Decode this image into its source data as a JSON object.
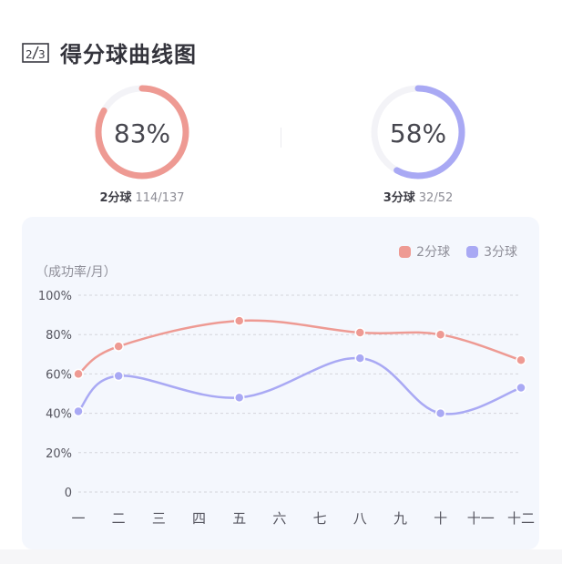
{
  "header": {
    "title": "得分球曲线图",
    "icon": "two-thirds-icon"
  },
  "stats": [
    {
      "percent_text": "83%",
      "value": 0.83,
      "label": "2分球",
      "detail": "114/137",
      "color": "#ee9a93"
    },
    {
      "percent_text": "58%",
      "value": 0.58,
      "label": "3分球",
      "detail": "32/52",
      "color": "#a9a9f4"
    }
  ],
  "chart_data": {
    "type": "line",
    "ylabel": "（成功率/月）",
    "categories": [
      "一",
      "二",
      "三",
      "四",
      "五",
      "六",
      "七",
      "八",
      "九",
      "十",
      "十一",
      "十二"
    ],
    "y_ticks": [
      "100%",
      "80%",
      "60%",
      "40%",
      "20%",
      "0"
    ],
    "ylim": [
      0,
      100
    ],
    "grid": true,
    "legend_position": "top-right",
    "series": [
      {
        "name": "2分球",
        "color": "#ee9a93",
        "points": [
          [
            1,
            60
          ],
          [
            2,
            74
          ],
          [
            5,
            87
          ],
          [
            8,
            81
          ],
          [
            10,
            80
          ],
          [
            12,
            67
          ]
        ]
      },
      {
        "name": "3分球",
        "color": "#a9a9f4",
        "points": [
          [
            1,
            41
          ],
          [
            2,
            59
          ],
          [
            5,
            48
          ],
          [
            8,
            68
          ],
          [
            10,
            40
          ],
          [
            12,
            53
          ]
        ]
      }
    ]
  }
}
